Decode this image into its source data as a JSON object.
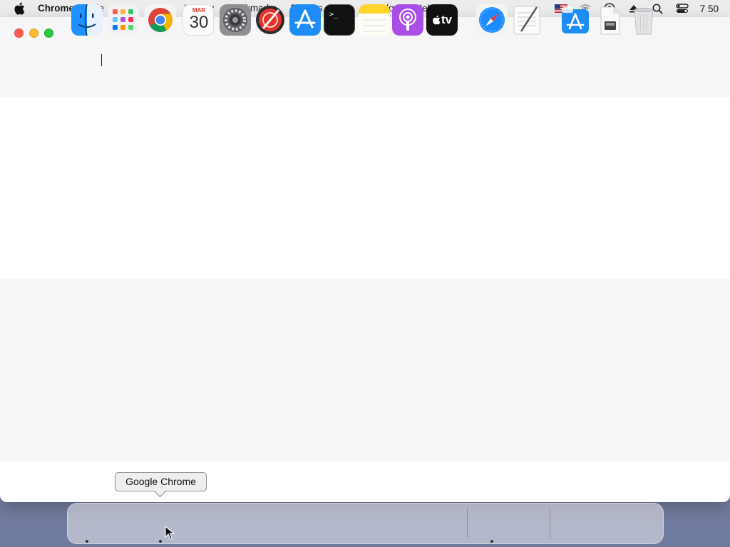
{
  "menubar": {
    "app_name": "Chrome",
    "items": [
      "File",
      "Edit",
      "View",
      "History",
      "Bookmarks",
      "Profiles",
      "Tab",
      "Window",
      "Help"
    ],
    "clock": "7 50",
    "status_icons": [
      "flag-us-icon",
      "wifi-icon",
      "user-account-icon",
      "eject-icon",
      "spotlight-search-icon",
      "control-center-icon"
    ]
  },
  "window": {
    "buttons": [
      "close",
      "minimize",
      "maximize"
    ]
  },
  "tooltip": {
    "text": "Google Chrome"
  },
  "dock": {
    "calendar": {
      "month": "MAR",
      "day": "30"
    },
    "tv_label": "tv",
    "terminal_prompt": ">_",
    "apps": [
      {
        "name": "Finder",
        "running": true
      },
      {
        "name": "Launchpad",
        "running": false
      },
      {
        "name": "Google Chrome",
        "running": true
      },
      {
        "name": "Calendar",
        "running": false
      },
      {
        "name": "System Preferences",
        "running": false
      },
      {
        "name": "Instruments",
        "running": false
      },
      {
        "name": "App Store",
        "running": false
      },
      {
        "name": "Terminal",
        "running": false
      },
      {
        "name": "Notes",
        "running": false
      },
      {
        "name": "Podcasts",
        "running": false
      },
      {
        "name": "Apple TV",
        "running": false
      },
      {
        "name": "Safari",
        "running": true
      },
      {
        "name": "TextEdit",
        "running": false
      },
      {
        "name": "App Store Downloads",
        "running": false
      },
      {
        "name": "Documents",
        "running": false
      },
      {
        "name": "Trash",
        "running": false
      }
    ]
  },
  "colors": {
    "close": "#ff5f57",
    "minimize": "#febc2e",
    "maximize": "#28c840"
  }
}
